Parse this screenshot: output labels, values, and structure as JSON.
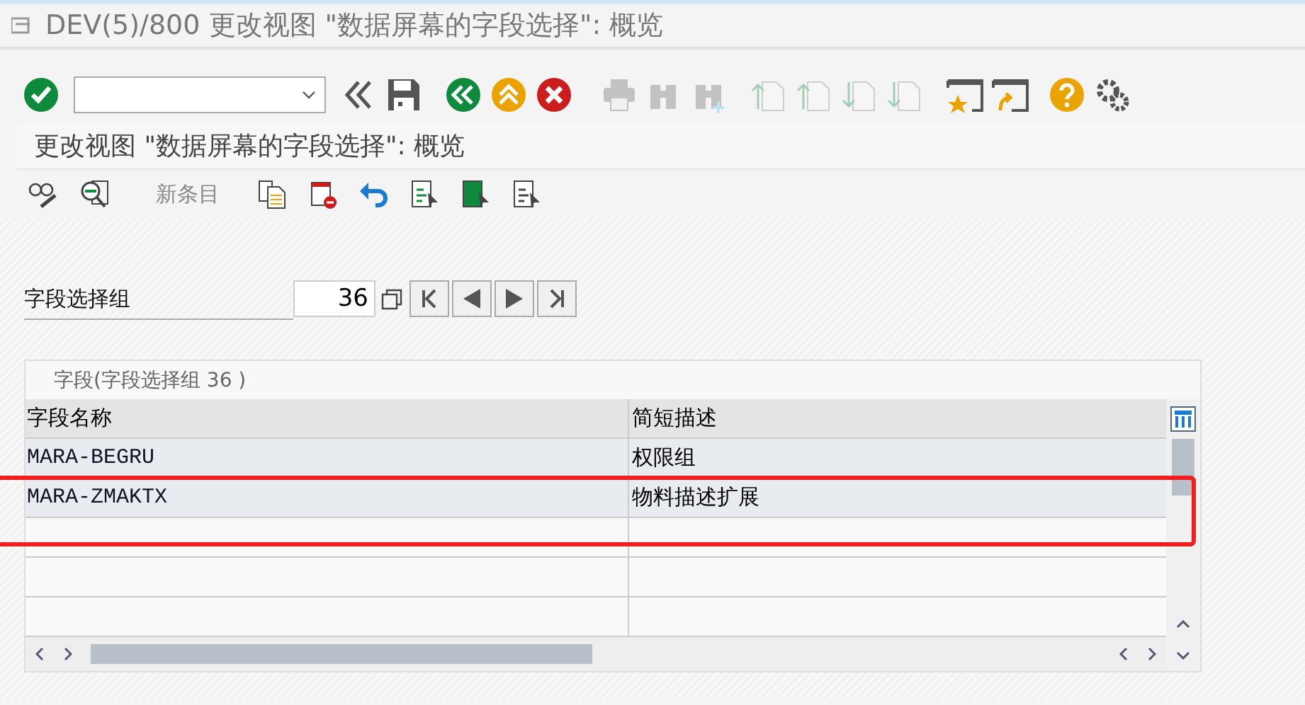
{
  "window": {
    "title": "DEV(5)/800 更改视图 \"数据屏幕的字段选择\": 概览"
  },
  "system_toolbar": [
    {
      "kind": "enter",
      "disabled": false
    },
    {
      "kind": "command"
    },
    {
      "kind": "collapse",
      "disabled": false
    },
    {
      "kind": "save",
      "disabled": false
    },
    {
      "kind": "back",
      "disabled": false
    },
    {
      "kind": "exit",
      "disabled": false
    },
    {
      "kind": "cancel",
      "disabled": false
    },
    {
      "kind": "print",
      "disabled": true
    },
    {
      "kind": "find",
      "disabled": true
    },
    {
      "kind": "find-next",
      "disabled": true
    },
    {
      "kind": "first-page",
      "disabled": true
    },
    {
      "kind": "prev-page",
      "disabled": true
    },
    {
      "kind": "next-page",
      "disabled": true
    },
    {
      "kind": "last-page",
      "disabled": true
    },
    {
      "kind": "new-session",
      "disabled": false
    },
    {
      "kind": "shortcut",
      "disabled": false
    },
    {
      "kind": "help",
      "disabled": false
    },
    {
      "kind": "settings",
      "disabled": false
    }
  ],
  "screen_title": "更改视图 \"数据屏幕的字段选择\": 概览",
  "app_toolbar": [
    {
      "kind": "display-change",
      "disabled": false
    },
    {
      "kind": "details",
      "disabled": false
    },
    {
      "kind": "text",
      "label": "新条目",
      "disabled": true
    },
    {
      "kind": "copy",
      "disabled": false
    },
    {
      "kind": "delete",
      "disabled": false
    },
    {
      "kind": "undo",
      "disabled": false
    },
    {
      "kind": "select-all",
      "disabled": false
    },
    {
      "kind": "select-block",
      "disabled": false
    },
    {
      "kind": "deselect-all",
      "disabled": false
    }
  ],
  "field": {
    "label": "字段选择组",
    "value": "36"
  },
  "table": {
    "title": "字段(字段选择组  36 )",
    "columns": [
      "字段名称",
      "简短描述"
    ],
    "rows": [
      [
        "MARA-BEGRU",
        "权限组"
      ],
      [
        "MARA-ZMAKTX",
        "物料描述扩展"
      ]
    ]
  }
}
